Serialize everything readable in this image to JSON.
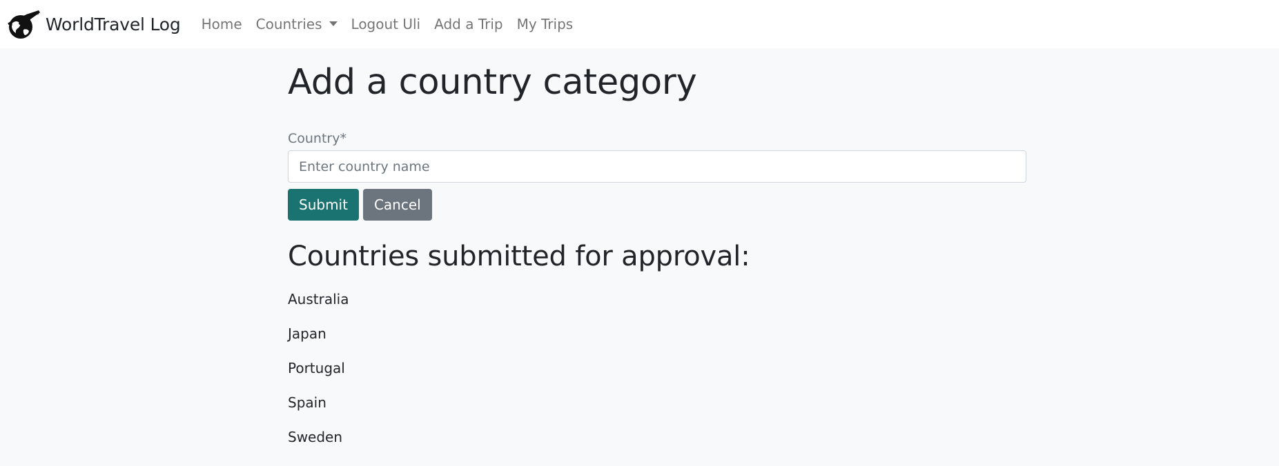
{
  "navbar": {
    "brand": "WorldTravel Log",
    "logo_icon": "globe-airplane-icon",
    "links": [
      {
        "label": "Home"
      },
      {
        "label": "Countries",
        "dropdown": true
      },
      {
        "label": "Logout Uli"
      },
      {
        "label": "Add a Trip"
      },
      {
        "label": "My Trips"
      }
    ]
  },
  "page": {
    "title": "Add a country category",
    "form": {
      "country_label": "Country*",
      "country_placeholder": "Enter country name",
      "country_value": "",
      "submit_label": "Submit",
      "cancel_label": "Cancel"
    },
    "submitted_heading": "Countries submitted for approval:",
    "submitted_countries": [
      "Australia",
      "Japan",
      "Portugal",
      "Spain",
      "Sweden"
    ]
  },
  "colors": {
    "submit_button": "#1a7370",
    "cancel_button": "#6c757d",
    "page_background": "#f8f9fa",
    "navbar_background": "#ffffff"
  }
}
